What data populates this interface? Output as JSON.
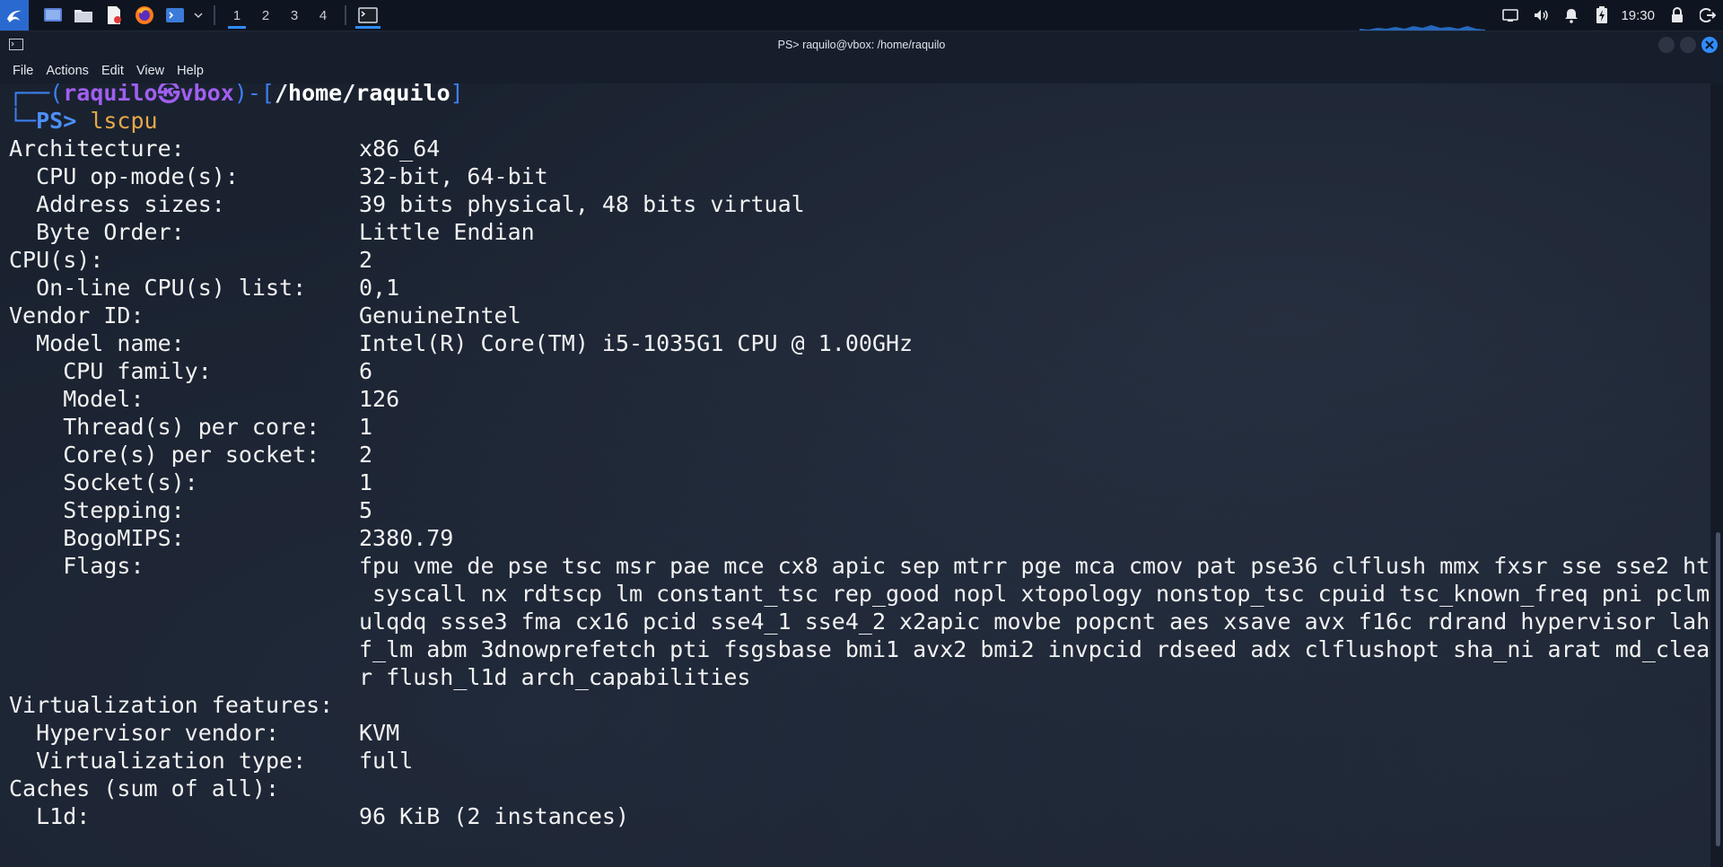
{
  "taskbar": {
    "workspaces": [
      "1",
      "2",
      "3",
      "4"
    ],
    "active_workspace": 1,
    "clock": "19:30"
  },
  "window": {
    "title": "PS> raquilo@vbox: /home/raquilo",
    "menu": [
      "File",
      "Actions",
      "Edit",
      "View",
      "Help"
    ]
  },
  "terminal": {
    "prompt": {
      "user": "raquilo",
      "host": "vbox",
      "path": "/home/raquilo",
      "ps": "PS>",
      "command": "lscpu"
    },
    "rows": [
      {
        "key": "Architecture:",
        "value": "x86_64"
      },
      {
        "key": "  CPU op-mode(s):",
        "value": "32-bit, 64-bit"
      },
      {
        "key": "  Address sizes:",
        "value": "39 bits physical, 48 bits virtual"
      },
      {
        "key": "  Byte Order:",
        "value": "Little Endian"
      },
      {
        "key": "CPU(s):",
        "value": "2"
      },
      {
        "key": "  On-line CPU(s) list:",
        "value": "0,1"
      },
      {
        "key": "Vendor ID:",
        "value": "GenuineIntel"
      },
      {
        "key": "  Model name:",
        "value": "Intel(R) Core(TM) i5-1035G1 CPU @ 1.00GHz"
      },
      {
        "key": "    CPU family:",
        "value": "6"
      },
      {
        "key": "    Model:",
        "value": "126"
      },
      {
        "key": "    Thread(s) per core:",
        "value": "1"
      },
      {
        "key": "    Core(s) per socket:",
        "value": "2"
      },
      {
        "key": "    Socket(s):",
        "value": "1"
      },
      {
        "key": "    Stepping:",
        "value": "5"
      },
      {
        "key": "    BogoMIPS:",
        "value": "2380.79"
      },
      {
        "key": "    Flags:",
        "value": ""
      }
    ],
    "flags_lines": [
      "fpu vme de pse tsc msr pae mce cx8 apic sep mtrr pge mca cmov pat pse36 clflush mmx fxsr sse sse2 ht",
      " syscall nx rdtscp lm constant_tsc rep_good nopl xtopology nonstop_tsc cpuid tsc_known_freq pni pclm",
      "ulqdq ssse3 fma cx16 pcid sse4_1 sse4_2 x2apic movbe popcnt aes xsave avx f16c rdrand hypervisor lah",
      "f_lm abm 3dnowprefetch pti fsgsbase bmi1 avx2 bmi2 invpcid rdseed adx clflushopt sha_ni arat md_clea",
      "r flush_l1d arch_capabilities"
    ],
    "rows_after": [
      {
        "key": "Virtualization features:",
        "value": ""
      },
      {
        "key": "  Hypervisor vendor:",
        "value": "KVM"
      },
      {
        "key": "  Virtualization type:",
        "value": "full"
      },
      {
        "key": "Caches (sum of all):",
        "value": ""
      },
      {
        "key": "  L1d:",
        "value": "96 KiB (2 instances)"
      }
    ]
  }
}
